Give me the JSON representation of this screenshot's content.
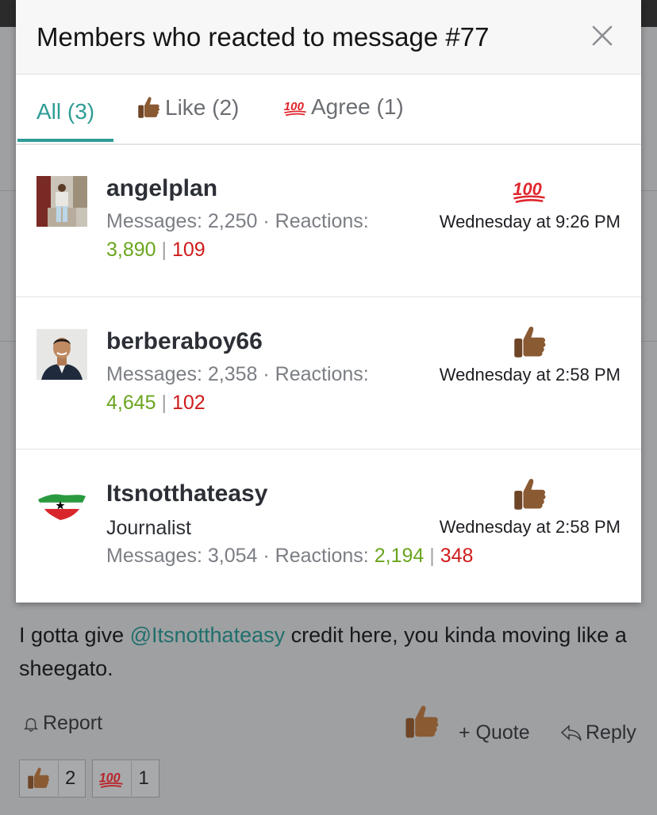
{
  "modal": {
    "title": "Members who reacted to message #77",
    "tabs": [
      {
        "label": "All (3)",
        "icon": "",
        "active": true
      },
      {
        "label": "Like (2)",
        "icon": "thumbs-up-icon",
        "active": false
      },
      {
        "label": "Agree (1)",
        "icon": "hundred-icon",
        "active": false
      }
    ],
    "members": [
      {
        "name": "angelplan",
        "title": "",
        "messages_label": "Messages:",
        "messages": "2,250",
        "reactions_label": "Reactions:",
        "reactions_pos": "3,890",
        "reactions_neg": "109",
        "reaction": "hundred-icon",
        "time": "Wednesday at 9:26 PM"
      },
      {
        "name": "berberaboy66",
        "title": "",
        "messages_label": "Messages:",
        "messages": "2,358",
        "reactions_label": "Reactions:",
        "reactions_pos": "4,645",
        "reactions_neg": "102",
        "reaction": "thumbs-up-icon",
        "time": "Wednesday at 2:58 PM"
      },
      {
        "name": "Itsnotthateasy",
        "title": "Journalist",
        "messages_label": "Messages:",
        "messages": "3,054",
        "reactions_label": "Reactions:",
        "reactions_pos": "2,194",
        "reactions_neg": "348",
        "reaction": "thumbs-up-icon",
        "time": "Wednesday at 2:58 PM"
      }
    ],
    "separator": "·",
    "pipe": "|"
  },
  "post": {
    "text_before": "I gotta give ",
    "mention": "@Itsnotthateasy",
    "text_after": " credit here, you kinda moving like a sheegato.",
    "report_label": "Report",
    "quote_label": "+ Quote",
    "reply_label": "Reply",
    "reaction_counts": [
      {
        "icon": "thumbs-up-icon",
        "count": "2"
      },
      {
        "icon": "hundred-icon",
        "count": "1"
      }
    ]
  },
  "colors": {
    "accent": "#2f9c96",
    "positive": "#6aa51e",
    "negative": "#cf1b1b"
  }
}
